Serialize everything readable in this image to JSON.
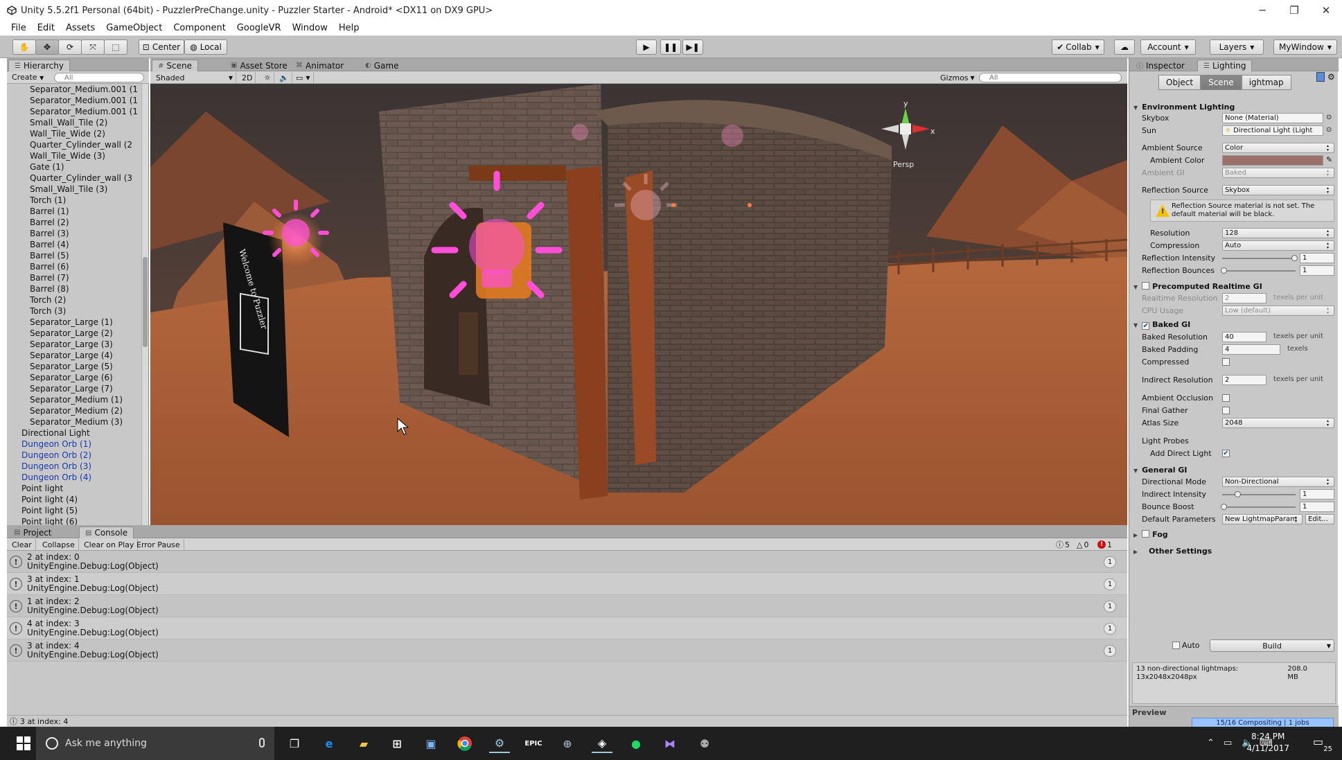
{
  "window": {
    "title": "Unity 5.5.2f1 Personal (64bit) - PuzzlerPreChange.unity - Puzzler Starter - Android* <DX11 on DX9 GPU>"
  },
  "menu": [
    "File",
    "Edit",
    "Assets",
    "GameObject",
    "Component",
    "GoogleVR",
    "Window",
    "Help"
  ],
  "toolbar": {
    "pivot": "Center",
    "space": "Local",
    "collab": "Collab",
    "account": "Account",
    "layers": "Layers",
    "layout": "MyWindow"
  },
  "tabs": {
    "hierarchy": "Hierarchy",
    "scene": "Scene",
    "asset_store": "Asset Store",
    "animator": "Animator",
    "game": "Game",
    "project": "Project",
    "console": "Console",
    "inspector": "Inspector",
    "lighting": "Lighting"
  },
  "hierarchy": {
    "create": "Create",
    "search_placeholder": "All",
    "items": [
      {
        "name": "Separator_Medium.001 (1",
        "blue": false
      },
      {
        "name": "Separator_Medium.001 (1",
        "blue": false
      },
      {
        "name": "Separator_Medium.001 (1",
        "blue": false
      },
      {
        "name": "Small_Wall_Tile (2)",
        "blue": false
      },
      {
        "name": "Wall_Tile_Wide (2)",
        "blue": false
      },
      {
        "name": "Quarter_Cylinder_wall (2",
        "blue": false
      },
      {
        "name": "Wall_Tile_Wide (3)",
        "blue": false
      },
      {
        "name": "Gate (1)",
        "blue": false
      },
      {
        "name": "Quarter_Cylinder_wall (3",
        "blue": false
      },
      {
        "name": "Small_Wall_Tile (3)",
        "blue": false
      },
      {
        "name": "Torch (1)",
        "blue": false
      },
      {
        "name": "Barrel (1)",
        "blue": false
      },
      {
        "name": "Barrel (2)",
        "blue": false
      },
      {
        "name": "Barrel (3)",
        "blue": false
      },
      {
        "name": "Barrel (4)",
        "blue": false
      },
      {
        "name": "Barrel (5)",
        "blue": false
      },
      {
        "name": "Barrel (6)",
        "blue": false
      },
      {
        "name": "Barrel (7)",
        "blue": false
      },
      {
        "name": "Barrel (8)",
        "blue": false
      },
      {
        "name": "Torch (2)",
        "blue": false
      },
      {
        "name": "Torch (3)",
        "blue": false
      },
      {
        "name": "Separator_Large (1)",
        "blue": false
      },
      {
        "name": "Separator_Large (2)",
        "blue": false
      },
      {
        "name": "Separator_Large (3)",
        "blue": false
      },
      {
        "name": "Separator_Large (4)",
        "blue": false
      },
      {
        "name": "Separator_Large (5)",
        "blue": false
      },
      {
        "name": "Separator_Large (6)",
        "blue": false
      },
      {
        "name": "Separator_Large (7)",
        "blue": false
      },
      {
        "name": "Separator_Medium (1)",
        "blue": false
      },
      {
        "name": "Separator_Medium (2)",
        "blue": false
      },
      {
        "name": "Separator_Medium (3)",
        "blue": false
      },
      {
        "name": "Directional Light",
        "blue": false,
        "root": true
      },
      {
        "name": "Dungeon Orb (1)",
        "blue": true,
        "root": true
      },
      {
        "name": "Dungeon Orb (2)",
        "blue": true,
        "root": true
      },
      {
        "name": "Dungeon Orb (3)",
        "blue": true,
        "root": true
      },
      {
        "name": "Dungeon Orb (4)",
        "blue": true,
        "root": true
      },
      {
        "name": "Point light",
        "blue": false,
        "root": true
      },
      {
        "name": "Point light (4)",
        "blue": false,
        "root": true
      },
      {
        "name": "Point light (5)",
        "blue": false,
        "root": true
      },
      {
        "name": "Point light (6)",
        "blue": false,
        "root": true
      }
    ]
  },
  "scene": {
    "shading": "Shaded",
    "mode_2d": "2D",
    "gizmos": "Gizmos",
    "search_placeholder": "All",
    "persp": "Persp",
    "axis_y": "y",
    "axis_x": "x",
    "sign_text": "Welcome to Puzzler"
  },
  "console": {
    "buttons": [
      "Clear",
      "Collapse",
      "Clear on Play",
      "Error Pause"
    ],
    "counts": {
      "info": "5",
      "warn": "0",
      "error": "1"
    },
    "logs": [
      {
        "line1": "2 at index: 0",
        "line2": "UnityEngine.Debug:Log(Object)",
        "count": "1"
      },
      {
        "line1": "3 at index: 1",
        "line2": "UnityEngine.Debug:Log(Object)",
        "count": "1"
      },
      {
        "line1": "1 at index: 2",
        "line2": "UnityEngine.Debug:Log(Object)",
        "count": "1"
      },
      {
        "line1": "4 at index: 3",
        "line2": "UnityEngine.Debug:Log(Object)",
        "count": "1"
      },
      {
        "line1": "3 at index: 4",
        "line2": "UnityEngine.Debug:Log(Object)",
        "count": "1"
      }
    ],
    "status": "3 at index: 4"
  },
  "lighting": {
    "modes": [
      "Object",
      "Scene",
      "ightmap"
    ],
    "env_header": "Environment Lighting",
    "skybox_label": "Skybox",
    "skybox_value": "None (Material)",
    "sun_label": "Sun",
    "sun_value": "Directional Light (Light",
    "ambient_source_label": "Ambient Source",
    "ambient_source_value": "Color",
    "ambient_color_label": "Ambient Color",
    "ambient_color": "#9b6f6a",
    "ambient_gi_label": "Ambient GI",
    "ambient_gi_value": "Baked",
    "reflection_source_label": "Reflection Source",
    "reflection_source_value": "Skybox",
    "warning": "Reflection Source material is not set. The default material will be black.",
    "resolution_label": "Resolution",
    "resolution_value": "128",
    "compression_label": "Compression",
    "compression_value": "Auto",
    "refl_intensity_label": "Reflection Intensity",
    "refl_intensity_value": "1",
    "refl_bounces_label": "Reflection Bounces",
    "refl_bounces_value": "1",
    "precomputed_header": "Precomputed Realtime GI",
    "realtime_res_label": "Realtime Resolution",
    "realtime_res_value": "2",
    "texels_per_unit": "texels per unit",
    "texels": "texels",
    "cpu_usage_label": "CPU Usage",
    "cpu_usage_value": "Low (default)",
    "baked_header": "Baked GI",
    "baked_res_label": "Baked Resolution",
    "baked_res_value": "40",
    "baked_padding_label": "Baked Padding",
    "baked_padding_value": "4",
    "compressed_label": "Compressed",
    "indirect_res_label": "Indirect Resolution",
    "indirect_res_value": "2",
    "ao_label": "Ambient Occlusion",
    "final_gather_label": "Final Gather",
    "atlas_label": "Atlas Size",
    "atlas_value": "2048",
    "light_probes_label": "Light Probes",
    "add_direct_label": "Add Direct Light",
    "general_header": "General GI",
    "dir_mode_label": "Directional Mode",
    "dir_mode_value": "Non-Directional",
    "indirect_intensity_label": "Indirect Intensity",
    "indirect_intensity_value": "1",
    "bounce_label": "Bounce Boost",
    "bounce_value": "1",
    "default_params_label": "Default Parameters",
    "default_params_value": "New LightmapParam",
    "edit_label": "Edit...",
    "fog_header": "Fog",
    "other_header": "Other Settings",
    "auto_label": "Auto",
    "build_label": "Build",
    "info_line1": "13 non-directional lightmaps:",
    "info_line2": "13x2048x2048px",
    "info_size": "208.0",
    "info_unit": "MB",
    "preview_label": "Preview",
    "progress_text": "15/16 Compositing | 1 jobs"
  },
  "taskbar": {
    "search_placeholder": "Ask me anything",
    "time": "8:24 PM",
    "date": "4/11/2017",
    "notifications": "25"
  },
  "colors": {
    "orb": "#ff4fd8",
    "sand": "#b0633a",
    "sky": "#474040",
    "progress": "#9ac4ff"
  }
}
